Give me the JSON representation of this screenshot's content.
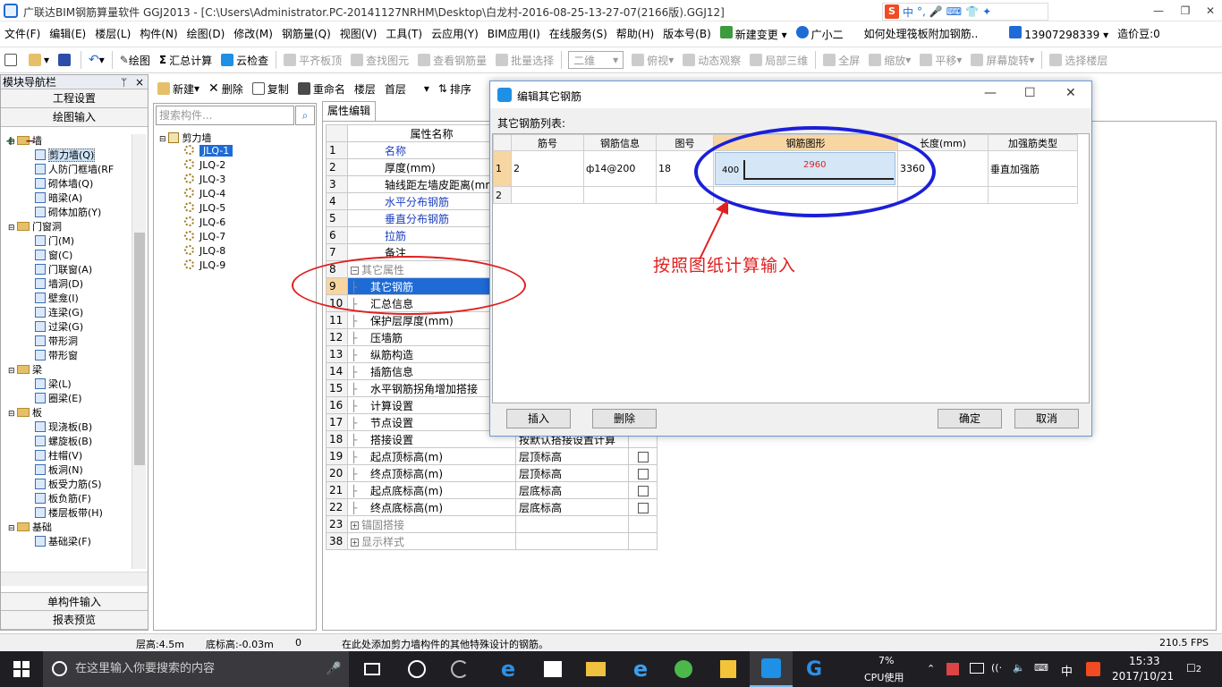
{
  "window": {
    "title": "广联达BIM钢筋算量软件 GGJ2013 - [C:\\Users\\Administrator.PC-20141127NRHM\\Desktop\\白龙村-2016-08-25-13-27-07(2166版).GGJ12]",
    "ime": {
      "logo": "S",
      "lang": "中",
      "punct": "°,"
    },
    "min": "—",
    "restore": "❐",
    "close": "✕"
  },
  "menu": [
    "文件(F)",
    "编辑(E)",
    "楼层(L)",
    "构件(N)",
    "绘图(D)",
    "修改(M)",
    "钢筋量(Q)",
    "视图(V)",
    "工具(T)",
    "云应用(Y)",
    "BIM应用(I)",
    "在线服务(S)",
    "帮助(H)",
    "版本号(B)",
    "新建变更",
    "广小二",
    "如何处理筏板附加钢筋..",
    "13907298339",
    "造价豆:0"
  ],
  "toolbar": {
    "draw": "绘图",
    "sum": "汇总计算",
    "cloud_check": "云检查",
    "level_top": "平齐板顶",
    "find": "查找图元",
    "view_qty": "查看钢筋量",
    "batch": "批量选择",
    "dim": "二维",
    "topview": "俯视",
    "dynamic": "动态观察",
    "local3d": "局部三维",
    "fullscreen": "全屏",
    "zoom": "缩放",
    "pan": "平移",
    "rotate": "屏幕旋转",
    "select_floor": "选择楼层"
  },
  "nav": {
    "header": "模块导航栏",
    "pin": "ᛘ",
    "close": "×",
    "btn_project": "工程设置",
    "btn_draw": "绘图输入",
    "btn_single": "单构件输入",
    "btn_report": "报表预览",
    "tree": [
      {
        "level": 0,
        "type": "folder",
        "label": "墙",
        "expand": "⊟"
      },
      {
        "level": 1,
        "type": "leaf",
        "label": "剪力墙(Q)",
        "selected": true
      },
      {
        "level": 1,
        "type": "leaf",
        "label": "人防门框墙(RF"
      },
      {
        "level": 1,
        "type": "leaf",
        "label": "砌体墙(Q)"
      },
      {
        "level": 1,
        "type": "leaf",
        "label": "暗梁(A)"
      },
      {
        "level": 1,
        "type": "leaf",
        "label": "砌体加筋(Y)"
      },
      {
        "level": 0,
        "type": "folder",
        "label": "门窗洞",
        "expand": "⊟"
      },
      {
        "level": 1,
        "type": "leaf",
        "label": "门(M)"
      },
      {
        "level": 1,
        "type": "leaf",
        "label": "窗(C)"
      },
      {
        "level": 1,
        "type": "leaf",
        "label": "门联窗(A)"
      },
      {
        "level": 1,
        "type": "leaf",
        "label": "墙洞(D)"
      },
      {
        "level": 1,
        "type": "leaf",
        "label": "壁龛(I)"
      },
      {
        "level": 1,
        "type": "leaf",
        "label": "连梁(G)"
      },
      {
        "level": 1,
        "type": "leaf",
        "label": "过梁(G)"
      },
      {
        "level": 1,
        "type": "leaf",
        "label": "带形洞"
      },
      {
        "level": 1,
        "type": "leaf",
        "label": "带形窗"
      },
      {
        "level": 0,
        "type": "folder",
        "label": "梁",
        "expand": "⊟"
      },
      {
        "level": 1,
        "type": "leaf",
        "label": "梁(L)"
      },
      {
        "level": 1,
        "type": "leaf",
        "label": "圈梁(E)"
      },
      {
        "level": 0,
        "type": "folder",
        "label": "板",
        "expand": "⊟"
      },
      {
        "level": 1,
        "type": "leaf",
        "label": "现浇板(B)"
      },
      {
        "level": 1,
        "type": "leaf",
        "label": "螺旋板(B)"
      },
      {
        "level": 1,
        "type": "leaf",
        "label": "柱帽(V)"
      },
      {
        "level": 1,
        "type": "leaf",
        "label": "板洞(N)"
      },
      {
        "level": 1,
        "type": "leaf",
        "label": "板受力筋(S)"
      },
      {
        "level": 1,
        "type": "leaf",
        "label": "板负筋(F)"
      },
      {
        "level": 1,
        "type": "leaf",
        "label": "楼层板带(H)"
      },
      {
        "level": 0,
        "type": "folder",
        "label": "基础",
        "expand": "⊟"
      },
      {
        "level": 1,
        "type": "leaf",
        "label": "基础梁(F)"
      }
    ],
    "expand_all": "+",
    "collapse_all": "−"
  },
  "comp_toolbar": {
    "new": "新建",
    "delete": "删除",
    "copy": "复制",
    "rename": "重命名",
    "floor_label": "楼层",
    "floor_value": "首层",
    "sort": "排序"
  },
  "comp_list": {
    "search_placeholder": "搜索构件...",
    "root": "剪力墙",
    "items": [
      "JLQ-1",
      "JLQ-2",
      "JLQ-3",
      "JLQ-4",
      "JLQ-5",
      "JLQ-6",
      "JLQ-7",
      "JLQ-8",
      "JLQ-9"
    ]
  },
  "prop": {
    "tab": "属性编辑",
    "header_name": "属性名称",
    "rows": [
      {
        "n": "1",
        "name": "名称",
        "style": "blue",
        "value": ""
      },
      {
        "n": "2",
        "name": "厚度(mm)",
        "style": "",
        "value": ""
      },
      {
        "n": "3",
        "name": "轴线距左墙皮距离(mm)",
        "style": "",
        "value": ""
      },
      {
        "n": "4",
        "name": "水平分布钢筋",
        "style": "blue",
        "value": ""
      },
      {
        "n": "5",
        "name": "垂直分布钢筋",
        "style": "blue",
        "value": ""
      },
      {
        "n": "6",
        "name": "拉筋",
        "style": "blue",
        "value": ""
      },
      {
        "n": "7",
        "name": "备注",
        "style": "",
        "value": ""
      },
      {
        "n": "8",
        "name": "其它属性",
        "style": "grey",
        "value": "",
        "group": "−"
      },
      {
        "n": "9",
        "name": "其它钢筋",
        "style": "sel",
        "value": "",
        "sub": true
      },
      {
        "n": "10",
        "name": "汇总信息",
        "style": "",
        "value": "",
        "sub": true
      },
      {
        "n": "11",
        "name": "保护层厚度(mm)",
        "style": "",
        "value": "",
        "sub": true
      },
      {
        "n": "12",
        "name": "压墙筋",
        "style": "",
        "value": "",
        "sub": true
      },
      {
        "n": "13",
        "name": "纵筋构造",
        "style": "",
        "value": "",
        "sub": true
      },
      {
        "n": "14",
        "name": "插筋信息",
        "style": "",
        "value": "",
        "sub": true
      },
      {
        "n": "15",
        "name": "水平钢筋拐角增加搭接",
        "style": "",
        "value": "",
        "sub": true
      },
      {
        "n": "16",
        "name": "计算设置",
        "style": "",
        "value": "",
        "sub": true
      },
      {
        "n": "17",
        "name": "节点设置",
        "style": "",
        "value": "",
        "sub": true
      },
      {
        "n": "18",
        "name": "搭接设置",
        "style": "",
        "value": "按默认搭接设置计算",
        "sub": true
      },
      {
        "n": "19",
        "name": "起点顶标高(m)",
        "style": "",
        "value": "层顶标高",
        "sub": true,
        "check": true
      },
      {
        "n": "20",
        "name": "终点顶标高(m)",
        "style": "",
        "value": "层顶标高",
        "sub": true,
        "check": true
      },
      {
        "n": "21",
        "name": "起点底标高(m)",
        "style": "",
        "value": "层底标高",
        "sub": true,
        "check": true
      },
      {
        "n": "22",
        "name": "终点底标高(m)",
        "style": "",
        "value": "层底标高",
        "sub": true,
        "check": true
      },
      {
        "n": "23",
        "name": "锚固搭接",
        "style": "grey",
        "value": "",
        "group": "+"
      },
      {
        "n": "38",
        "name": "显示样式",
        "style": "grey",
        "value": "",
        "group": "+"
      }
    ]
  },
  "dialog": {
    "title": "编辑其它钢筋",
    "min": "—",
    "max": "☐",
    "close": "✕",
    "list_label": "其它钢筋列表:",
    "headers": [
      "筋号",
      "钢筋信息",
      "图号",
      "钢筋图形",
      "长度(mm)",
      "加强筋类型"
    ],
    "rows": [
      {
        "idx": "1",
        "bar_no": "2",
        "info": "ф14@200",
        "fig": "18",
        "shape_left": "400",
        "shape_top": "2960",
        "length": "3360",
        "type": "垂直加强筋"
      },
      {
        "idx": "2",
        "bar_no": "",
        "info": "",
        "fig": "",
        "shape_left": "",
        "shape_top": "",
        "length": "",
        "type": ""
      }
    ],
    "btn_insert": "插入",
    "btn_delete": "删除",
    "btn_ok": "确定",
    "btn_cancel": "取消"
  },
  "annotation": {
    "text": "按照图纸计算输入",
    "color": "#e02020",
    "ellipse_blue": "#1b1fd8",
    "ellipse_red": "#e02020"
  },
  "status": {
    "floor_height": "层高:4.5m",
    "bottom_elev": "底标高:-0.03m",
    "zero": "0",
    "hint": "在此处添加剪力墙构件的其他特殊设计的钢筋。",
    "fps": "210.5 FPS"
  },
  "taskbar": {
    "search_placeholder": "在这里输入你要搜索的内容",
    "cpu_pct": "7%",
    "cpu_label": "CPU使用",
    "ime": "中",
    "time": "15:33",
    "date": "2017/10/21",
    "notif": "2"
  },
  "colors": {
    "accent": "#1e6bd6",
    "selected": "#1e6bd6",
    "header_hl": "#f7d6a2"
  }
}
